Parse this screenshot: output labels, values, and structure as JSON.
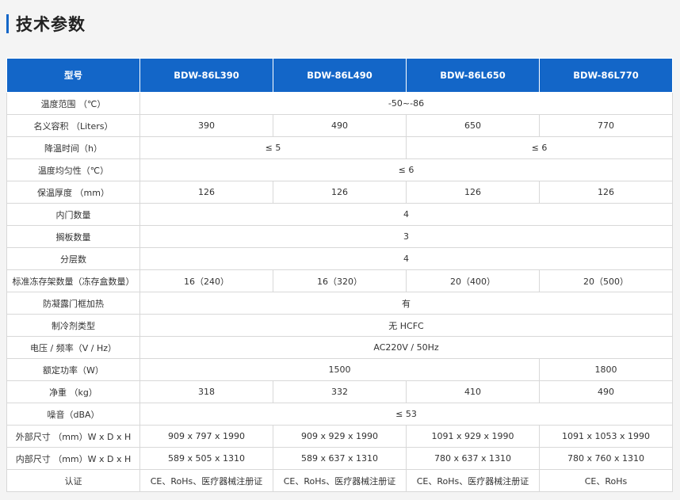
{
  "page": {
    "title": "技术参数"
  },
  "table": {
    "headers": [
      "型号",
      "BDW-86L390",
      "BDW-86L490",
      "BDW-86L650",
      "BDW-86L770"
    ],
    "rows": [
      {
        "label": "温度范围 （℃）",
        "cells": [
          {
            "v": "-50~-86",
            "span": 4
          }
        ]
      },
      {
        "label": "名义容积 （Liters）",
        "cells": [
          {
            "v": "390",
            "span": 1
          },
          {
            "v": "490",
            "span": 1
          },
          {
            "v": "650",
            "span": 1
          },
          {
            "v": "770",
            "span": 1
          }
        ]
      },
      {
        "label": "降温时间（h）",
        "cells": [
          {
            "v": "≤ 5",
            "span": 2
          },
          {
            "v": "≤ 6",
            "span": 2
          }
        ]
      },
      {
        "label": "温度均匀性（℃）",
        "cells": [
          {
            "v": "≤ 6",
            "span": 4
          }
        ]
      },
      {
        "label": "保温厚度 （mm）",
        "cells": [
          {
            "v": "126",
            "span": 1
          },
          {
            "v": "126",
            "span": 1
          },
          {
            "v": "126",
            "span": 1
          },
          {
            "v": "126",
            "span": 1
          }
        ]
      },
      {
        "label": "内门数量",
        "cells": [
          {
            "v": "4",
            "span": 4
          }
        ]
      },
      {
        "label": "搁板数量",
        "cells": [
          {
            "v": "3",
            "span": 4
          }
        ]
      },
      {
        "label": "分层数",
        "cells": [
          {
            "v": "4",
            "span": 4
          }
        ]
      },
      {
        "label": "标准冻存架数量（冻存盒数量）",
        "cells": [
          {
            "v": "16（240）",
            "span": 1
          },
          {
            "v": "16（320）",
            "span": 1
          },
          {
            "v": "20（400）",
            "span": 1
          },
          {
            "v": "20（500）",
            "span": 1
          }
        ]
      },
      {
        "label": "防凝露门框加热",
        "cells": [
          {
            "v": "有",
            "span": 4
          }
        ]
      },
      {
        "label": "制冷剂类型",
        "cells": [
          {
            "v": "无 HCFC",
            "span": 4
          }
        ]
      },
      {
        "label": "电压 / 频率（V / Hz）",
        "cells": [
          {
            "v": "AC220V / 50Hz",
            "span": 4
          }
        ]
      },
      {
        "label": "额定功率（W）",
        "cells": [
          {
            "v": "1500",
            "span": 3
          },
          {
            "v": "1800",
            "span": 1
          }
        ]
      },
      {
        "label": "净重 （kg）",
        "cells": [
          {
            "v": "318",
            "span": 1
          },
          {
            "v": "332",
            "span": 1
          },
          {
            "v": "410",
            "span": 1
          },
          {
            "v": "490",
            "span": 1
          }
        ]
      },
      {
        "label": "噪音（dBA）",
        "cells": [
          {
            "v": "≤ 53",
            "span": 4
          }
        ]
      },
      {
        "label": "外部尺寸 （mm）W x D x H",
        "cells": [
          {
            "v": "909 x 797 x 1990",
            "span": 1
          },
          {
            "v": "909 x 929 x 1990",
            "span": 1
          },
          {
            "v": "1091 x 929 x 1990",
            "span": 1
          },
          {
            "v": "1091 x 1053 x 1990",
            "span": 1
          }
        ]
      },
      {
        "label": "内部尺寸 （mm）W x D x H",
        "cells": [
          {
            "v": "589 x 505 x 1310",
            "span": 1
          },
          {
            "v": "589 x 637 x 1310",
            "span": 1
          },
          {
            "v": "780 x 637 x 1310",
            "span": 1
          },
          {
            "v": "780 x 760 x 1310",
            "span": 1
          }
        ]
      },
      {
        "label": "认证",
        "cells": [
          {
            "v": "CE、RoHs、医疗器械注册证",
            "span": 1
          },
          {
            "v": "CE、RoHs、医疗器械注册证",
            "span": 1
          },
          {
            "v": "CE、RoHs、医疗器械注册证",
            "span": 1
          },
          {
            "v": "CE、RoHs",
            "span": 1
          }
        ]
      }
    ]
  },
  "colors": {
    "header_bg": "#1366c8",
    "accent_bar": "#1366c8",
    "border": "#d8d8d8"
  }
}
